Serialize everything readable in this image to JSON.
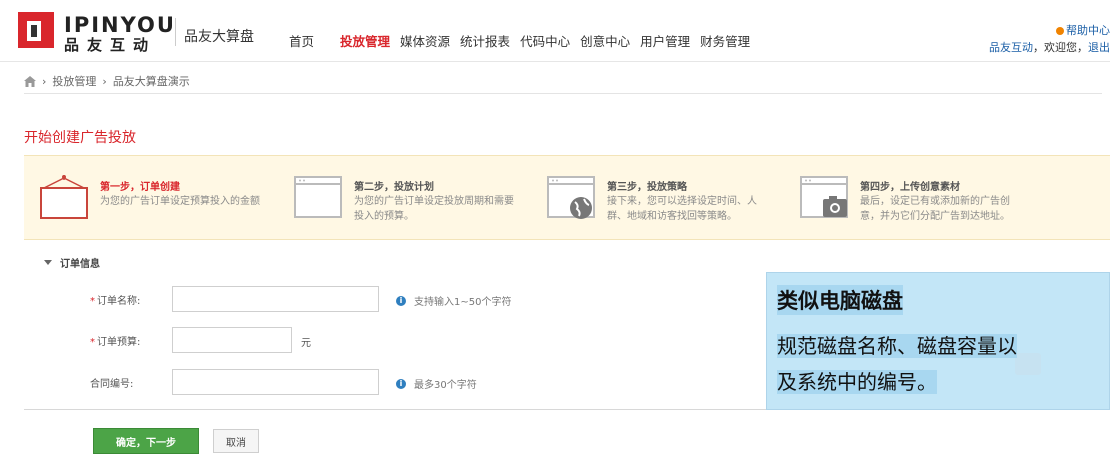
{
  "header": {
    "brand_en": "IPINYOU",
    "brand_cn": "品友互动",
    "product": "品友大算盘",
    "nav": [
      "首页",
      "投放管理",
      "媒体资源",
      "统计报表",
      "代码中心",
      "创意中心",
      "用户管理",
      "财务管理"
    ],
    "help": "帮助中心",
    "user_company": "品友互动",
    "welcome": "，欢迎您，",
    "logout": "退出"
  },
  "breadcrumb": {
    "items": [
      "投放管理",
      "品友大算盘演示"
    ]
  },
  "page_title": "开始创建广告投放",
  "steps": [
    {
      "title": "第一步，订单创建",
      "desc": "为您的广告订单设定预算投入的金额"
    },
    {
      "title": "第二步，投放计划",
      "desc": "为您的广告订单设定投放周期和需要投入的预算。"
    },
    {
      "title": "第三步，投放策略",
      "desc": "接下来，您可以选择设定时间、人群、地域和访客找回等策略。"
    },
    {
      "title": "第四步，上传创意素材",
      "desc": "最后，设定已有或添加新的广告创意，并为它们分配广告到达地址。"
    }
  ],
  "form": {
    "section_title": "订单信息",
    "order_name_label": "订单名称:",
    "order_name_hint": "支持输入1~50个字符",
    "order_budget_label": "订单预算:",
    "order_budget_unit": "元",
    "contract_label": "合同编号:",
    "contract_hint": "最多30个字符",
    "required_mark": "*",
    "order_name_value": "",
    "order_budget_value": "",
    "contract_value": ""
  },
  "buttons": {
    "next": "确定，下一步",
    "cancel": "取消"
  },
  "callout": {
    "title": "类似电脑磁盘",
    "line1": "规范磁盘名称、磁盘容量以",
    "line2": "及系统中的编号。"
  },
  "colors": {
    "accent_red": "#d9262c",
    "link_blue": "#1a5ea6",
    "step_bg": "#fff8e4",
    "button_green": "#4ca447",
    "callout_bg": "#bee4f6"
  }
}
